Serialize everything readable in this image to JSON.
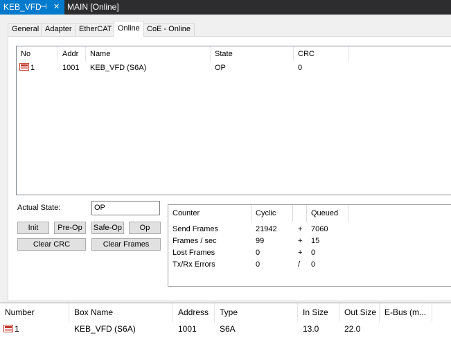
{
  "doc_tabs": {
    "active": "KEB_VFD",
    "pin_glyph": "⊣",
    "close_glyph": "✕",
    "other": "MAIN [Online]"
  },
  "prop_tabs": [
    "General",
    "Adapter",
    "EtherCAT",
    "Online",
    "CoE - Online"
  ],
  "slave_list": {
    "columns": [
      "No",
      "Addr",
      "Name",
      "State",
      "CRC"
    ],
    "rows": [
      {
        "no": "1",
        "addr": "1001",
        "name": "KEB_VFD (S6A)",
        "state": "OP",
        "crc": "0"
      }
    ]
  },
  "state_panel": {
    "actual_state_label": "Actual State:",
    "actual_state_value": "OP",
    "init": "Init",
    "preop": "Pre-Op",
    "safeop": "Safe-Op",
    "op": "Op",
    "clear_crc": "Clear CRC",
    "clear_frames": "Clear Frames"
  },
  "counters": {
    "headers": [
      "Counter",
      "Cyclic",
      "Queued"
    ],
    "rows": [
      {
        "label": "Send Frames",
        "cyclic": "21942",
        "op": "+",
        "queued": "7060"
      },
      {
        "label": "Frames / sec",
        "cyclic": "99",
        "op": "+",
        "queued": "15"
      },
      {
        "label": "Lost Frames",
        "cyclic": "0",
        "op": "+",
        "queued": "0"
      },
      {
        "label": "Tx/Rx Errors",
        "cyclic": "0",
        "op": "/",
        "queued": "0"
      }
    ]
  },
  "bottom_grid": {
    "columns": [
      "Number",
      "Box Name",
      "Address",
      "Type",
      "In Size",
      "Out Size",
      "E-Bus (m..."
    ],
    "rows": [
      {
        "number": "1",
        "box_name": "KEB_VFD (S6A)",
        "address": "1001",
        "type": "S6A",
        "in_size": "13.0",
        "out_size": "22.0",
        "ebus": ""
      }
    ]
  },
  "colors": {
    "accent": "#007acc",
    "tab_bar": "#2d2d30",
    "device_icon": "#c0392b"
  }
}
